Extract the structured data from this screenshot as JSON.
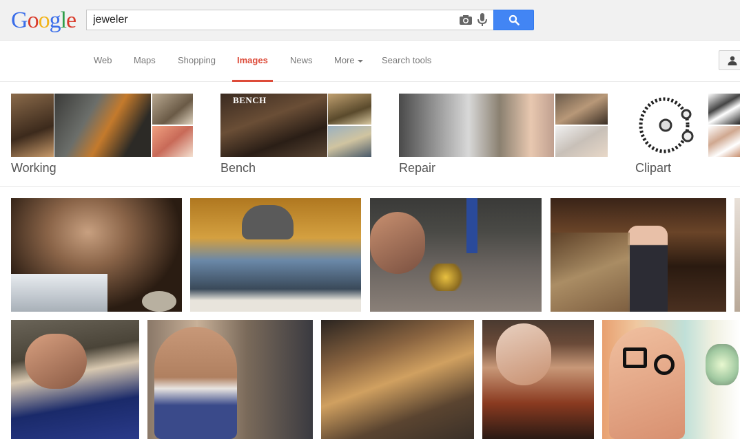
{
  "logo": {
    "letters": [
      "G",
      "o",
      "o",
      "g",
      "l",
      "e"
    ],
    "colors": [
      "#3b6ee9",
      "#d93b2b",
      "#f2b41a",
      "#3b6ee9",
      "#2f9d48",
      "#d93b2b"
    ]
  },
  "search": {
    "value": "jeweler",
    "placeholder": ""
  },
  "tabs": [
    {
      "label": "Web"
    },
    {
      "label": "Maps"
    },
    {
      "label": "Shopping"
    },
    {
      "label": "Images"
    },
    {
      "label": "News"
    },
    {
      "label": "More"
    },
    {
      "label": "Search tools"
    }
  ],
  "active_tab": "Images",
  "categories": [
    {
      "label": "Working"
    },
    {
      "label": "Bench",
      "overlay": "BENCH"
    },
    {
      "label": "Repair"
    },
    {
      "label": "Clipart"
    }
  ],
  "colors": {
    "accent_blue": "#4285f4",
    "active_red": "#dd4b39",
    "tab_gray": "#777777"
  },
  "icons": [
    "camera-icon",
    "microphone-icon",
    "search-icon",
    "account-icon"
  ]
}
